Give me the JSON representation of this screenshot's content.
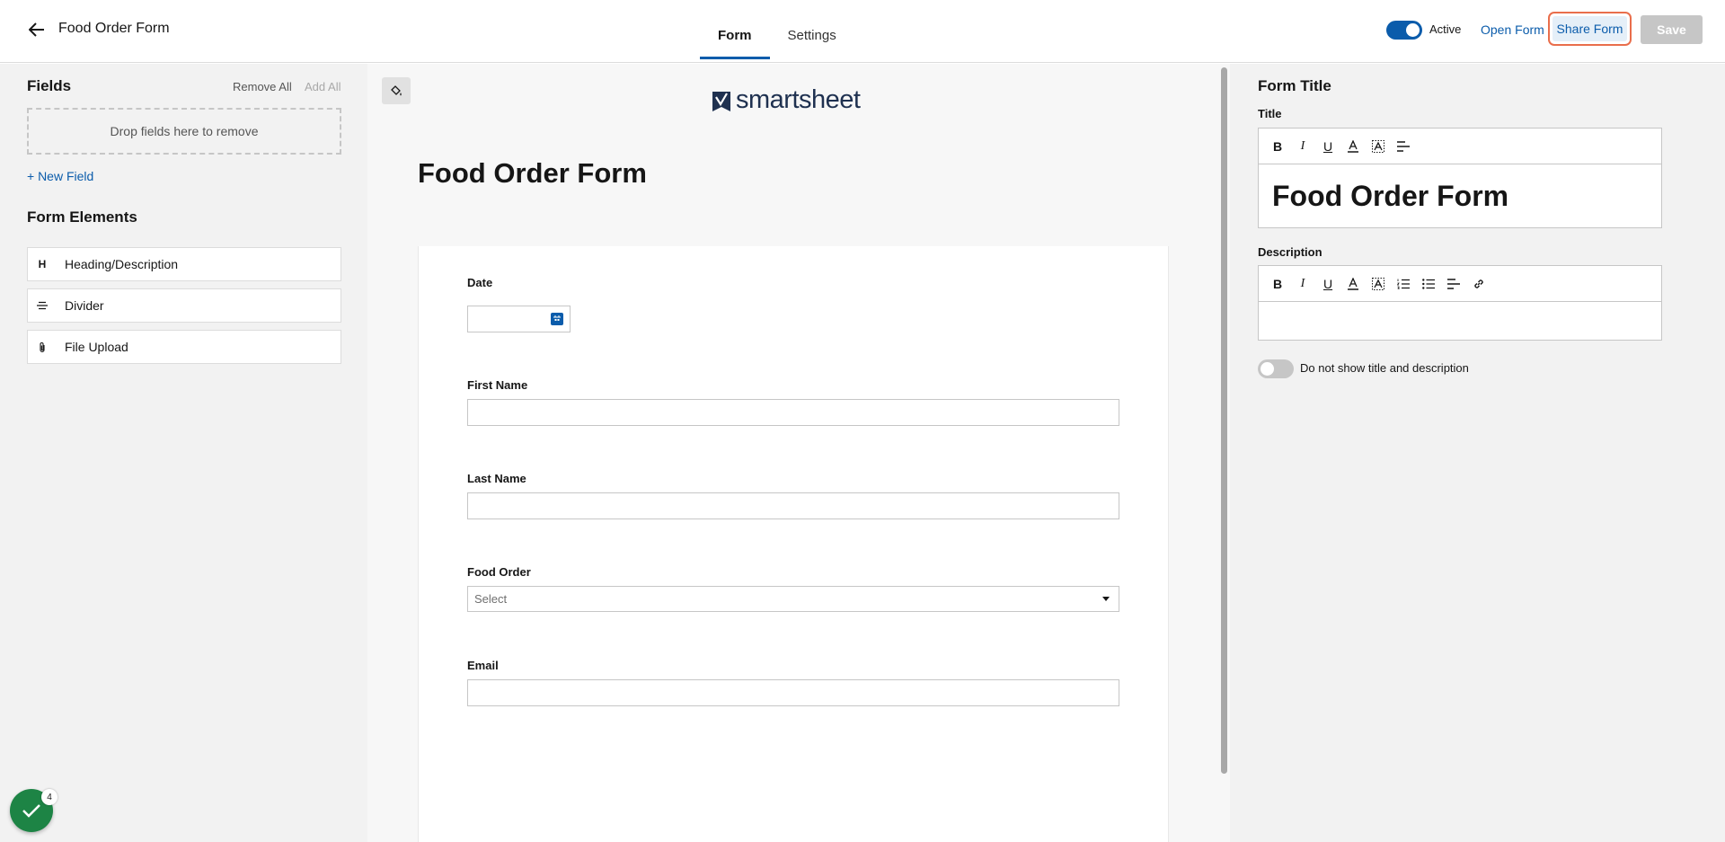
{
  "header": {
    "title": "Food Order Form",
    "tabs": [
      {
        "label": "Form",
        "active": true
      },
      {
        "label": "Settings",
        "active": false
      }
    ],
    "active_label": "Active",
    "open_form": "Open Form",
    "share_form": "Share Form",
    "save": "Save"
  },
  "left": {
    "fields_title": "Fields",
    "remove_all": "Remove All",
    "add_all": "Add All",
    "drop_zone": "Drop fields here to remove",
    "new_field": "+ New Field",
    "elements_title": "Form Elements",
    "elements": [
      {
        "icon": "heading-icon",
        "glyph": "H",
        "label": "Heading/Description"
      },
      {
        "icon": "divider-icon",
        "glyph": "",
        "label": "Divider"
      },
      {
        "icon": "paperclip-icon",
        "glyph": "",
        "label": "File Upload"
      }
    ],
    "badge_count": "4"
  },
  "center": {
    "logo_text": "smartsheet",
    "form_heading": "Food Order Form",
    "fields": {
      "date": "Date",
      "first_name": "First Name",
      "last_name": "Last Name",
      "food_order": "Food Order",
      "food_order_placeholder": "Select",
      "email": "Email"
    }
  },
  "right": {
    "section_title": "Form Title",
    "title_label": "Title",
    "title_value": "Food Order Form",
    "description_label": "Description",
    "description_value": "",
    "hide_label": "Do not show title and description"
  },
  "colors": {
    "accent": "#0b5cab",
    "highlight": "#e96e4c",
    "success": "#1d8445"
  }
}
